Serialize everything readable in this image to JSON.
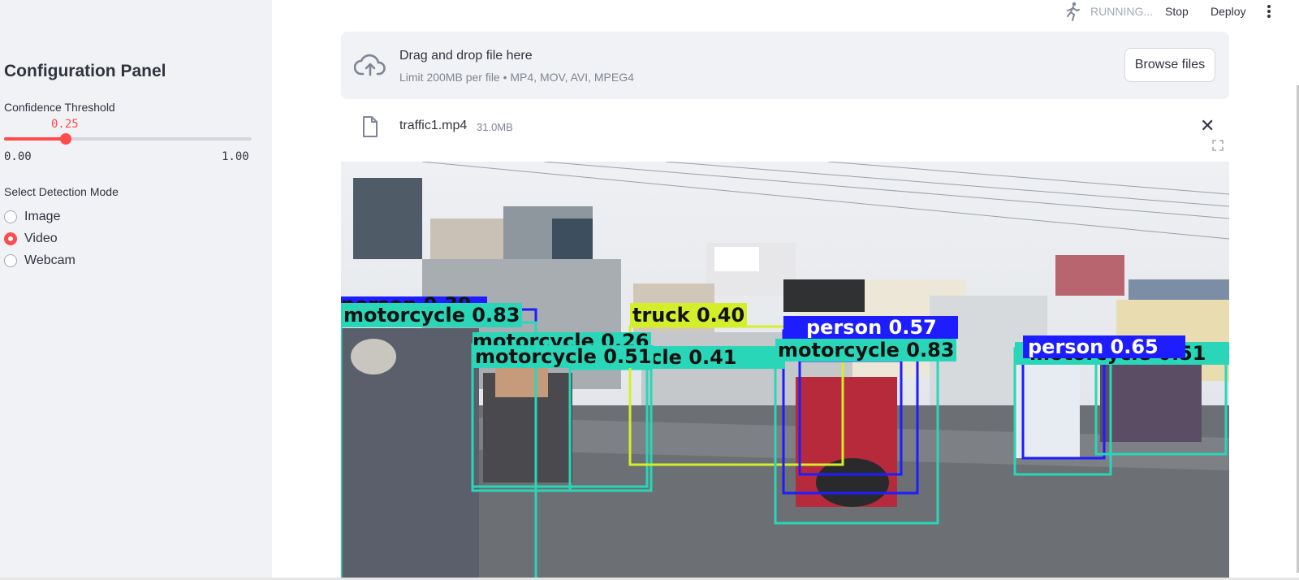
{
  "sidebar": {
    "title": "Configuration Panel",
    "confidence": {
      "label": "Confidence Threshold",
      "value_text": "0.25",
      "value": 0.25,
      "min": "0.00",
      "max": "1.00"
    },
    "mode": {
      "label": "Select Detection Mode",
      "options": [
        "Image",
        "Video",
        "Webcam"
      ],
      "selected": "Video"
    }
  },
  "topbar": {
    "status": "RUNNING...",
    "stop_label": "Stop",
    "deploy_label": "Deploy"
  },
  "uploader": {
    "title": "Drag and drop file here",
    "limit": "Limit 200MB per file • MP4, MOV, AVI, MPEG4",
    "browse_label": "Browse files"
  },
  "file": {
    "name": "traffic1.mp4",
    "size": "31.0MB"
  },
  "video": {
    "detections": [
      {
        "label": "person 0.39",
        "color": "#1d1dff"
      },
      {
        "label": "motorcycle 0.83",
        "color": "#29d6b8"
      },
      {
        "label": "motorcycle 0.26",
        "color": "#29d6b8"
      },
      {
        "label": "motorcycle 0.51",
        "color": "#29d6b8"
      },
      {
        "label": "motorcycle 0.41",
        "color": "#29d6b8"
      },
      {
        "label": "truck 0.40",
        "color": "#d4ef2a"
      },
      {
        "label": "person 0.57",
        "color": "#1d1dff"
      },
      {
        "label": "motorcycle 0.83",
        "color": "#29d6b8"
      },
      {
        "label": "person 0.65",
        "color": "#1d1dff"
      },
      {
        "label": "motorcycle 0.51",
        "color": "#29d6b8"
      }
    ]
  },
  "colors": {
    "accent": "#ff4b4b",
    "sidebar_bg": "#f0f2f6"
  }
}
